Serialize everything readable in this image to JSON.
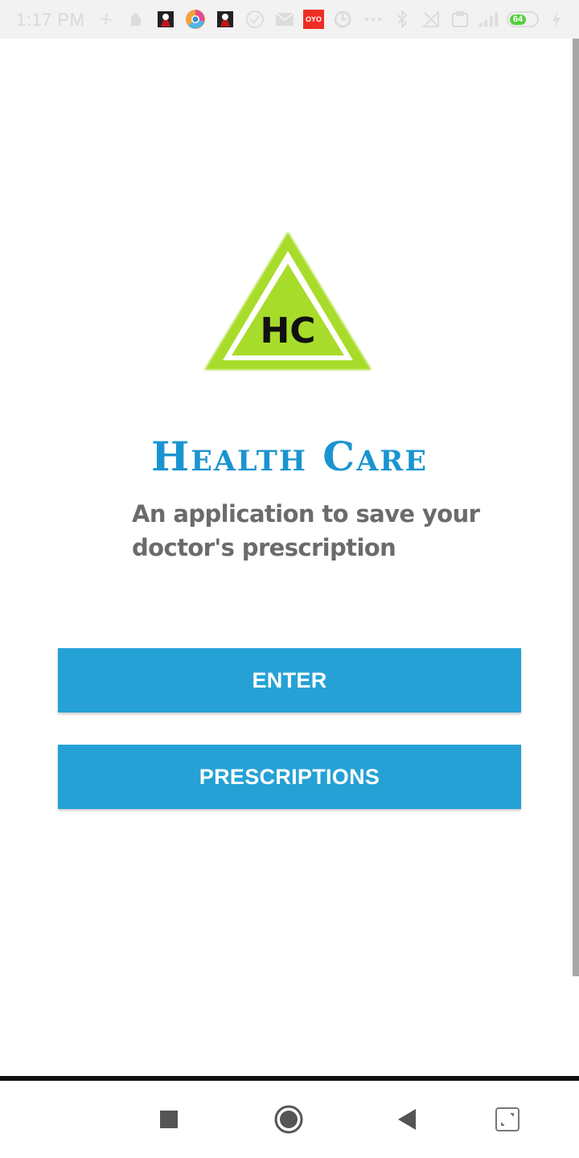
{
  "status_bar": {
    "time": "1:17 PM",
    "oyo_label": "OYO",
    "battery_level": "64",
    "icons": [
      "fan-icon",
      "hand-icon",
      "app-icon",
      "chrome-dev-icon",
      "app-icon",
      "check-icon",
      "mail-icon",
      "oyo-icon",
      "sync-icon",
      "more-dots-icon",
      "bluetooth-icon",
      "no-signal-icon",
      "data-icon",
      "signal-icon",
      "battery-icon",
      "charging-icon"
    ]
  },
  "app": {
    "logo_text": "HC",
    "title": "Health Care",
    "subtitle_line1": "An application to save your",
    "subtitle_line2": "doctor's prescription"
  },
  "buttons": {
    "enter_label": "ENTER",
    "prescriptions_label": "PRESCRIPTIONS"
  },
  "colors": {
    "brand_blue": "#1a94d0",
    "button_blue": "#25a1d6",
    "logo_green": "#a8dc2a",
    "subtitle_gray": "#6b6b6b"
  },
  "nav": {
    "icons": [
      "recents-square-icon",
      "home-circle-icon",
      "back-triangle-icon",
      "expand-icon"
    ]
  }
}
